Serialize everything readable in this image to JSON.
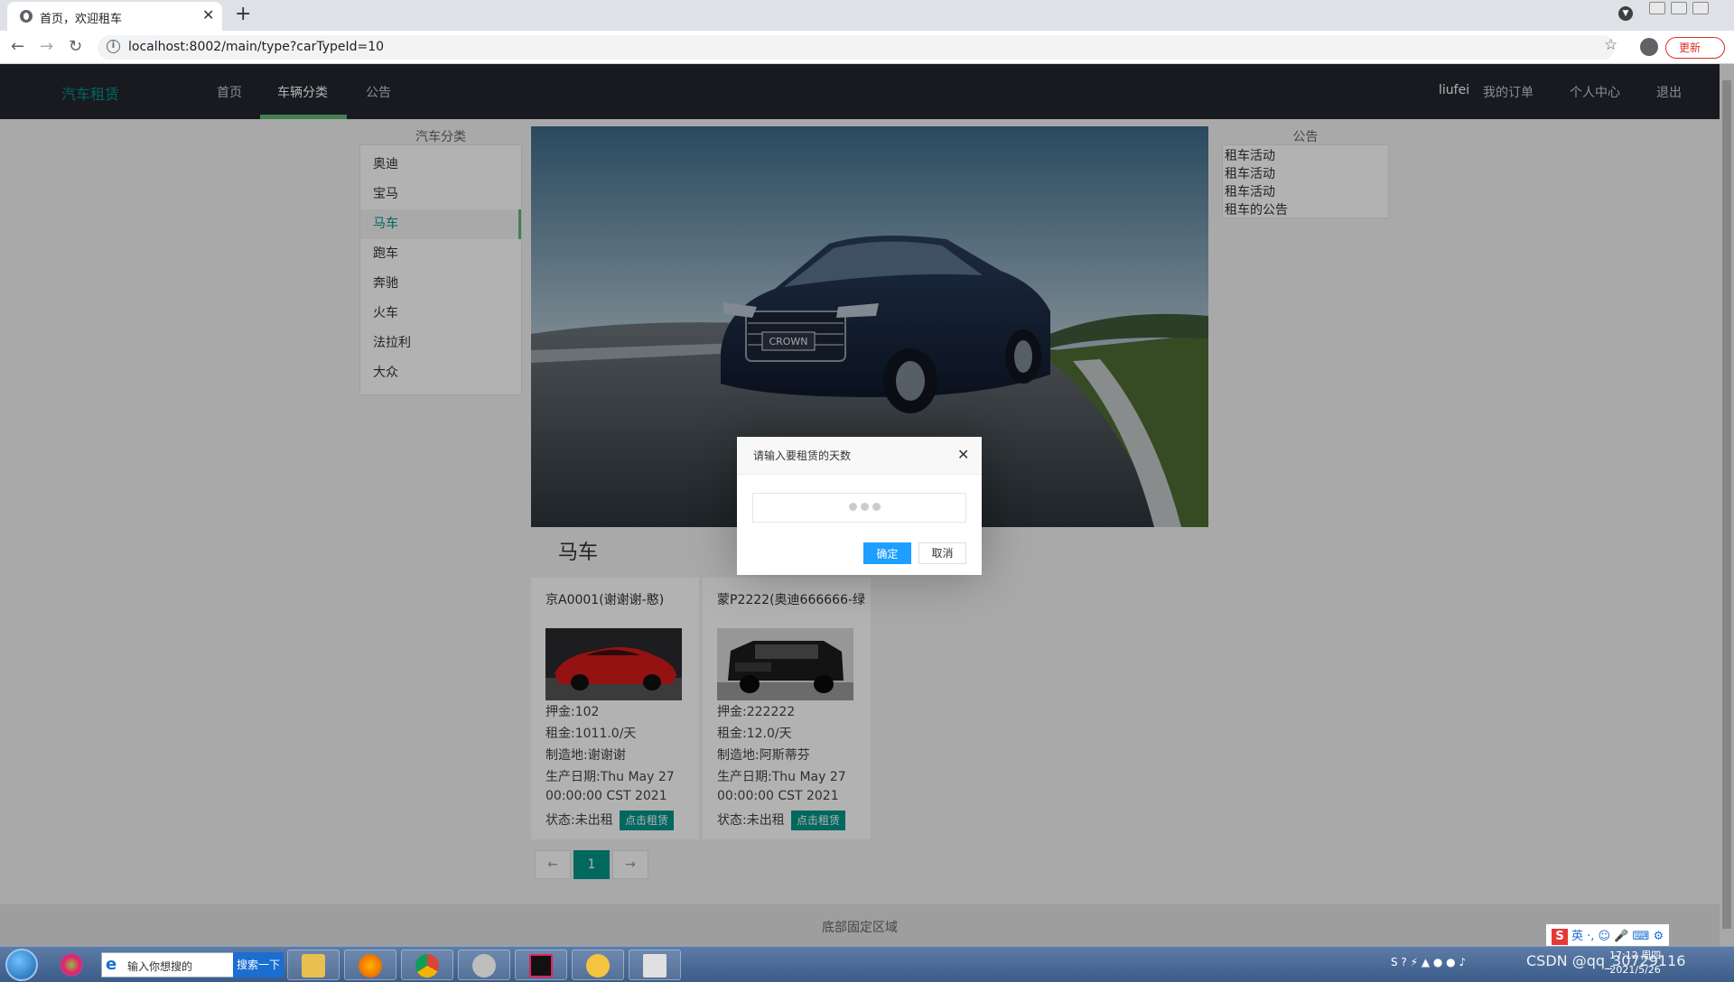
{
  "browser": {
    "tab_title": "首页，欢迎租车",
    "url": "localhost:8002/main/type?carTypeId=10",
    "update_label": "更新"
  },
  "site": {
    "logo": "汽车租赁",
    "nav": [
      "首页",
      "车辆分类",
      "公告"
    ],
    "active_nav": "车辆分类",
    "user": "liufei",
    "my_orders": "我的订单",
    "profile": "个人中心",
    "logout": "退出"
  },
  "sidebar": {
    "title": "汽车分类",
    "items": [
      "奥迪",
      "宝马",
      "马车",
      "跑车",
      "奔驰",
      "火车",
      "法拉利",
      "大众"
    ],
    "active": "马车"
  },
  "main": {
    "category_title": "马车",
    "hero_badge": "CROWN",
    "cars": [
      {
        "name": "京A0001(谢谢谢-憨)",
        "deposit": "押金:102",
        "rent": "租金:1011.0/天",
        "origin": "制造地:谢谢谢",
        "date1": "生产日期:Thu May 27",
        "date2": "00:00:00 CST 2021",
        "status": "状态:未出租",
        "button": "点击租赁"
      },
      {
        "name": "蒙P2222(奥迪666666-绿",
        "deposit": "押金:222222",
        "rent": "租金:12.0/天",
        "origin": "制造地:阿斯蒂芬",
        "date1": "生产日期:Thu May 27",
        "date2": "00:00:00 CST 2021",
        "status": "状态:未出租",
        "button": "点击租赁"
      }
    ],
    "pager": {
      "prev": "←",
      "current": "1",
      "next": "→"
    }
  },
  "notices": {
    "title": "公告",
    "items": [
      "租车活动",
      "租车活动",
      "租车活动",
      "租车的公告"
    ]
  },
  "footer": {
    "text": "底部固定区域"
  },
  "dialog": {
    "title": "请输入要租赁的天数",
    "input_value": "",
    "ok": "确定",
    "cancel": "取消"
  },
  "taskbar": {
    "search_placeholder": "输入你想搜的",
    "search_button": "搜索一下",
    "ime": "英",
    "date": "2021/5/26",
    "time": "17:12 周四"
  },
  "watermark": "CSDN @qq_30729116"
}
